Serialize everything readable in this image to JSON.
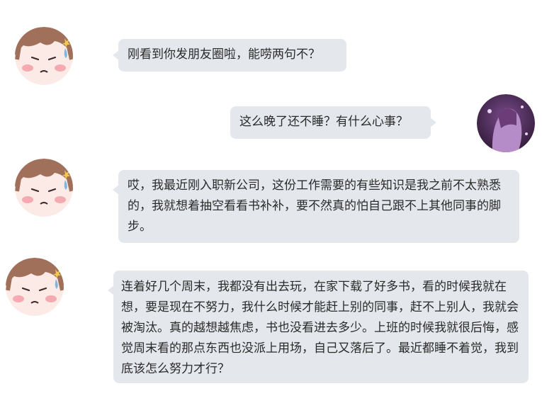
{
  "colors": {
    "bubble_bg": "#e4e7eb",
    "text": "#2a2a2a",
    "page_bg": "#ffffff"
  },
  "messages": [
    {
      "side": "left",
      "avatar": "cartoon-girl-avatar",
      "text": "刚看到你发朋友圈啦，能唠两句不？"
    },
    {
      "side": "right",
      "avatar": "photo-avatar",
      "text": "这么晚了还不睡？有什么心事？"
    },
    {
      "side": "left",
      "avatar": "cartoon-girl-avatar",
      "text": "哎，我最近刚入职新公司，这份工作需要的有些知识是我之前不太熟悉的，我就想着抽空看看书补补，要不然真的怕自己跟不上其他同事的脚步。"
    },
    {
      "side": "left",
      "avatar": "cartoon-girl-avatar",
      "text": "连着好几个周末，我都没有出去玩，在家下载了好多书，看的时候我就在想，要是现在不努力，我什么时候才能赶上别的同事，赶不上别人，我就会被淘汰。真的越想越焦虑，书也没看进去多少。上班的时候我就很后悔，感觉周末看的那点东西也没派上用场，自己又落后了。最近都睡不着觉，我到底该怎么努力才行？"
    }
  ]
}
